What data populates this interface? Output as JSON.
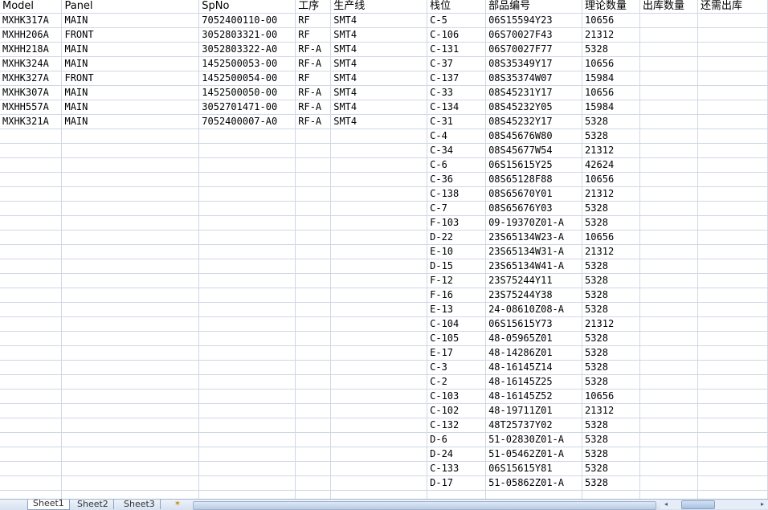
{
  "headers": [
    "Model",
    "Panel",
    "SpNo",
    "工序",
    "生产线",
    "栈位",
    "部品编号",
    "理论数量",
    "出库数量",
    "还需出库"
  ],
  "rows": [
    [
      "MXHK317A",
      "MAIN",
      "7052400110-00",
      "RF",
      "SMT4",
      "C-5",
      "06S15594Y23",
      "10656",
      "",
      ""
    ],
    [
      "MXHH206A",
      "FRONT",
      "3052803321-00",
      "RF",
      "SMT4",
      "C-106",
      "06S70027F43",
      "21312",
      "",
      ""
    ],
    [
      "MXHH218A",
      "MAIN",
      "3052803322-A0",
      "RF-A",
      "SMT4",
      "C-131",
      "06S70027F77",
      "5328",
      "",
      ""
    ],
    [
      "MXHK324A",
      "MAIN",
      "1452500053-00",
      "RF-A",
      "SMT4",
      "C-37",
      "08S35349Y17",
      "10656",
      "",
      ""
    ],
    [
      "MXHK327A",
      "FRONT",
      "1452500054-00",
      "RF",
      "SMT4",
      "C-137",
      "08S35374W07",
      "15984",
      "",
      ""
    ],
    [
      "MXHK307A",
      "MAIN",
      "1452500050-00",
      "RF-A",
      "SMT4",
      "C-33",
      "08S45231Y17",
      "10656",
      "",
      ""
    ],
    [
      "MXHH557A",
      "MAIN",
      "3052701471-00",
      "RF-A",
      "SMT4",
      "C-134",
      "08S45232Y05",
      "15984",
      "",
      ""
    ],
    [
      "MXHK321A",
      "MAIN",
      "7052400007-A0",
      "RF-A",
      "SMT4",
      "C-31",
      "08S45232Y17",
      "5328",
      "",
      ""
    ],
    [
      "",
      "",
      "",
      "",
      "",
      "C-4",
      "08S45676W80",
      "5328",
      "",
      ""
    ],
    [
      "",
      "",
      "",
      "",
      "",
      "C-34",
      "08S45677W54",
      "21312",
      "",
      ""
    ],
    [
      "",
      "",
      "",
      "",
      "",
      "C-6",
      "06S15615Y25",
      "42624",
      "",
      ""
    ],
    [
      "",
      "",
      "",
      "",
      "",
      "C-36",
      "08S65128F88",
      "10656",
      "",
      ""
    ],
    [
      "",
      "",
      "",
      "",
      "",
      "C-138",
      "08S65670Y01",
      "21312",
      "",
      ""
    ],
    [
      "",
      "",
      "",
      "",
      "",
      "C-7",
      "08S65676Y03",
      "5328",
      "",
      ""
    ],
    [
      "",
      "",
      "",
      "",
      "",
      "F-103",
      "09-19370Z01-A",
      "5328",
      "",
      ""
    ],
    [
      "",
      "",
      "",
      "",
      "",
      "D-22",
      "23S65134W23-A",
      "10656",
      "",
      ""
    ],
    [
      "",
      "",
      "",
      "",
      "",
      "E-10",
      "23S65134W31-A",
      "21312",
      "",
      ""
    ],
    [
      "",
      "",
      "",
      "",
      "",
      "D-15",
      "23S65134W41-A",
      "5328",
      "",
      ""
    ],
    [
      "",
      "",
      "",
      "",
      "",
      "F-12",
      "23S75244Y11",
      "5328",
      "",
      ""
    ],
    [
      "",
      "",
      "",
      "",
      "",
      "F-16",
      "23S75244Y38",
      "5328",
      "",
      ""
    ],
    [
      "",
      "",
      "",
      "",
      "",
      "E-13",
      "24-08610Z08-A",
      "5328",
      "",
      ""
    ],
    [
      "",
      "",
      "",
      "",
      "",
      "C-104",
      "06S15615Y73",
      "21312",
      "",
      ""
    ],
    [
      "",
      "",
      "",
      "",
      "",
      "C-105",
      "48-05965Z01",
      "5328",
      "",
      ""
    ],
    [
      "",
      "",
      "",
      "",
      "",
      "E-17",
      "48-14286Z01",
      "5328",
      "",
      ""
    ],
    [
      "",
      "",
      "",
      "",
      "",
      "C-3",
      "48-16145Z14",
      "5328",
      "",
      ""
    ],
    [
      "",
      "",
      "",
      "",
      "",
      "C-2",
      "48-16145Z25",
      "5328",
      "",
      ""
    ],
    [
      "",
      "",
      "",
      "",
      "",
      "C-103",
      "48-16145Z52",
      "10656",
      "",
      ""
    ],
    [
      "",
      "",
      "",
      "",
      "",
      "C-102",
      "48-19711Z01",
      "21312",
      "",
      ""
    ],
    [
      "",
      "",
      "",
      "",
      "",
      "C-132",
      "48T25737Y02",
      "5328",
      "",
      ""
    ],
    [
      "",
      "",
      "",
      "",
      "",
      "D-6",
      "51-02830Z01-A",
      "5328",
      "",
      ""
    ],
    [
      "",
      "",
      "",
      "",
      "",
      "D-24",
      "51-05462Z01-A",
      "5328",
      "",
      ""
    ],
    [
      "",
      "",
      "",
      "",
      "",
      "C-133",
      "06S15615Y81",
      "5328",
      "",
      ""
    ],
    [
      "",
      "",
      "",
      "",
      "",
      "D-17",
      "51-05862Z01-A",
      "5328",
      "",
      ""
    ],
    [
      "",
      "",
      "",
      "",
      "",
      "",
      "",
      "",
      "",
      ""
    ]
  ],
  "sheet_tabs": [
    "Sheet1",
    "Sheet2",
    "Sheet3"
  ],
  "active_tab": "Sheet1",
  "scroll_left_icon": "◂",
  "scroll_right_icon": "▸",
  "new_sheet_icon": "✶"
}
